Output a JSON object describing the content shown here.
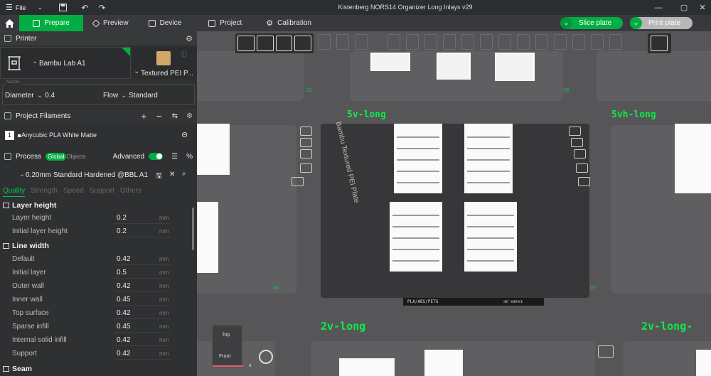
{
  "window": {
    "file_label": "File",
    "title": "Kistenberg NORS14 Organizer Long Inlays v29"
  },
  "tabs": [
    {
      "label": "Prepare",
      "icon": "cube-icon"
    },
    {
      "label": "Preview",
      "icon": "layers-icon"
    },
    {
      "label": "Device",
      "icon": "monitor-icon"
    },
    {
      "label": "Project",
      "icon": "document-icon"
    },
    {
      "label": "Calibration",
      "icon": "gauge-icon"
    }
  ],
  "actions": {
    "slice": "Slice plate",
    "print": "Print plate"
  },
  "printer": {
    "section": "Printer",
    "name": "Bambu Lab A1",
    "plate": "Textured PEI P...",
    "nozzle_legend": "Nozzle",
    "diameter_label": "Diameter",
    "diameter_value": "0.4",
    "flow_label": "Flow",
    "flow_value": "Standard"
  },
  "filaments": {
    "section": "Project Filaments",
    "items": [
      {
        "index": "1",
        "name": "Anycubic PLA White Matte"
      }
    ]
  },
  "process": {
    "section": "Process",
    "toggle_global": "Global",
    "toggle_objects": "Objects",
    "advanced_label": "Advanced",
    "advanced_on": true,
    "profile": "0.20mm Standard Hardened @BBL A1",
    "tabs": [
      "Quality",
      "Strength",
      "Speed",
      "Support",
      "Others"
    ]
  },
  "settings": [
    {
      "group": "Layer height",
      "rows": [
        {
          "label": "Layer height",
          "value": "0.2",
          "unit": "mm"
        },
        {
          "label": "Initial layer height",
          "value": "0.2",
          "unit": "mm"
        }
      ]
    },
    {
      "group": "Line width",
      "rows": [
        {
          "label": "Default",
          "value": "0.42",
          "unit": "mm"
        },
        {
          "label": "Initial layer",
          "value": "0.5",
          "unit": "mm"
        },
        {
          "label": "Outer wall",
          "value": "0.42",
          "unit": "mm"
        },
        {
          "label": "Inner wall",
          "value": "0.45",
          "unit": "mm"
        },
        {
          "label": "Top surface",
          "value": "0.42",
          "unit": "mm"
        },
        {
          "label": "Sparse infill",
          "value": "0.45",
          "unit": "mm"
        },
        {
          "label": "Internal solid infill",
          "value": "0.42",
          "unit": "mm"
        },
        {
          "label": "Support",
          "value": "0.42",
          "unit": "mm"
        }
      ]
    },
    {
      "group": "Seam",
      "rows": []
    }
  ],
  "viewport": {
    "plate_labels": [
      "5v-long",
      "5vh-long",
      "2v-long",
      "2v-long-"
    ],
    "plate_numbers": [
      "02",
      "05",
      "06",
      "07"
    ],
    "bed_text": "Bambu Textured PEI Plate",
    "bed_strip": "PLA/ABS/PETG",
    "bed_strip_right": "HOT SURFACE",
    "cube_top": "Top",
    "cube_front": "Front",
    "axis_x": "x"
  },
  "colors": {
    "accent": "#00ae42",
    "plate_label": "#0eea45"
  }
}
